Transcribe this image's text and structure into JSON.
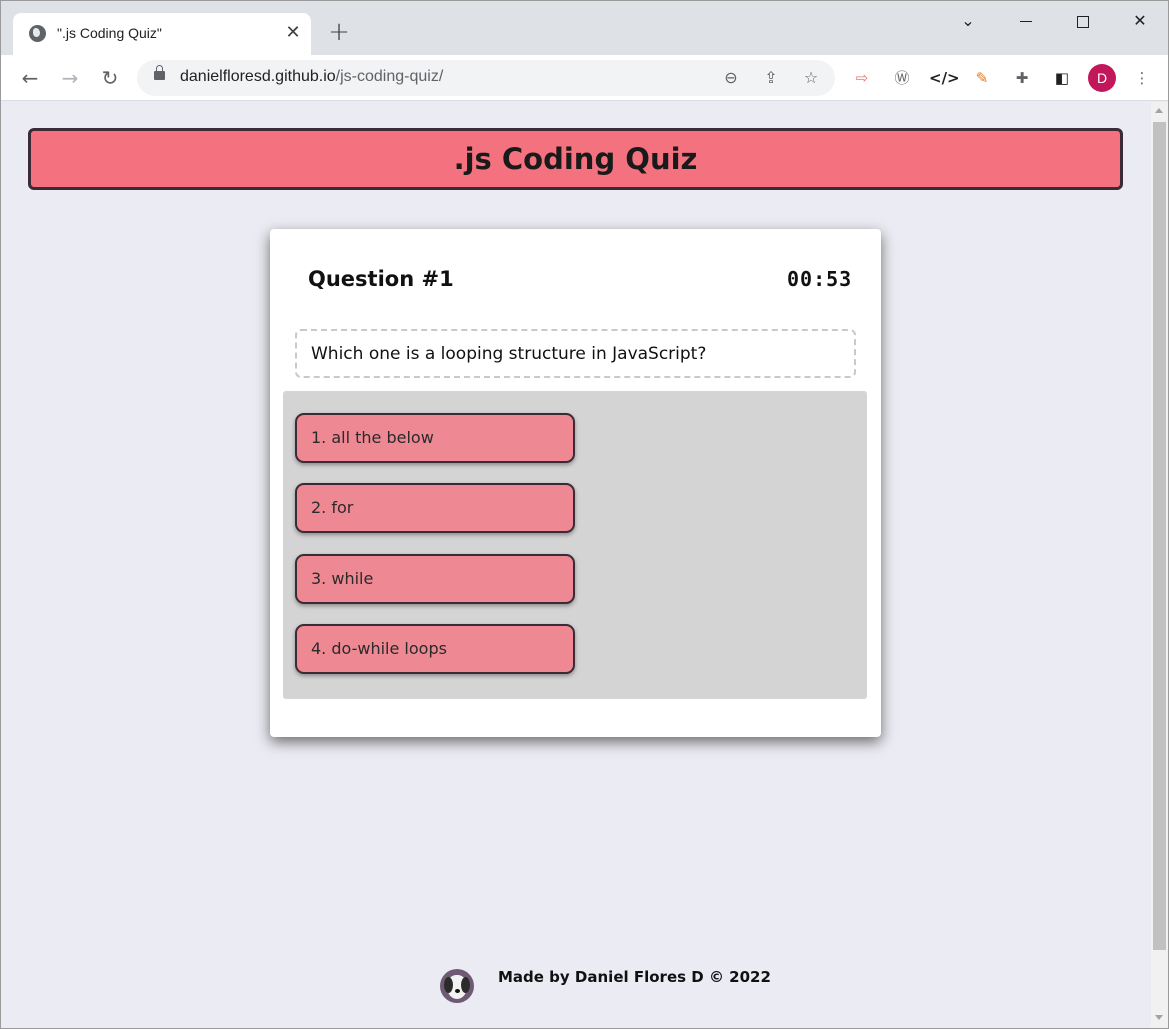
{
  "browser": {
    "tab_title": "\".js Coding Quiz\"",
    "tab_close": "✕",
    "new_tab": "+",
    "url_domain": "danielfloresd.github.io",
    "url_path": "/js-coding-quiz/",
    "profile_initial": "D"
  },
  "page": {
    "header_title": ".js Coding Quiz",
    "question_label": "Question #1",
    "timer": "00:53",
    "question_text": "Which one is a looping structure in JavaScript?",
    "answers": [
      "1. all the below",
      "2. for",
      "3. while",
      "4. do-while loops"
    ],
    "footer_credit": "Made by Daniel Flores D © 2022"
  },
  "colors": {
    "header_bg": "#f4727f",
    "answer_bg": "#ee8893",
    "page_bg": "#ebebf3",
    "answers_panel": "#d4d4d4"
  }
}
